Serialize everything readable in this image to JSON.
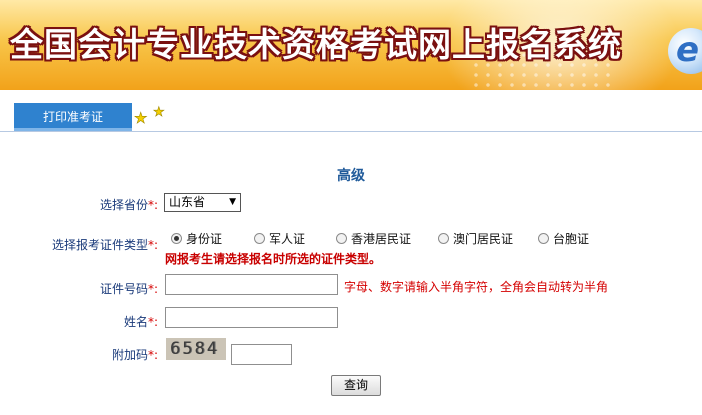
{
  "header": {
    "title": "全国会计专业技术资格考试网上报名系统",
    "logo_letter": "e"
  },
  "tabs": {
    "active_label": "打印准考证",
    "decor_icons": [
      "star-icon",
      "star-icon"
    ]
  },
  "page": {
    "level": "高级"
  },
  "form": {
    "province": {
      "label": "选择省份",
      "required_mark": "*:",
      "selected": "山东省"
    },
    "id_type": {
      "label": "选择报考证件类型",
      "required_mark": "*:",
      "options": [
        {
          "label": "身份证",
          "checked": true
        },
        {
          "label": "军人证",
          "checked": false
        },
        {
          "label": "香港居民证",
          "checked": false
        },
        {
          "label": "澳门居民证",
          "checked": false
        },
        {
          "label": "台胞证",
          "checked": false
        }
      ],
      "notice": "网报考生请选择报名时所选的证件类型。"
    },
    "id_number": {
      "label": "证件号码",
      "required_mark": "*:",
      "value": "",
      "hint": "字母、数字请输入半角字符，全角会自动转为半角"
    },
    "name": {
      "label": "姓名",
      "required_mark": "*:",
      "value": ""
    },
    "captcha": {
      "label": "附加码",
      "required_mark": "*:",
      "image_text": "6584",
      "value": ""
    },
    "submit_label": "查询"
  },
  "colors": {
    "banner_top": "#ffe9a6",
    "banner_bottom": "#f2a21a",
    "tab_bg": "#2f82cf",
    "label_text": "#1a3a7a",
    "required_red": "#d40000",
    "level_text": "#1f5a9a"
  }
}
